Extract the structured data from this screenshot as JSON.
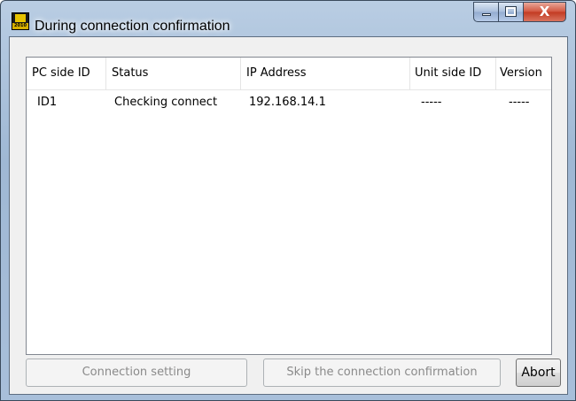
{
  "window": {
    "title": "During connection confirmation",
    "icon_name": "app-icon",
    "caption_buttons": {
      "minimize_icon": "minimize-icon",
      "maximize_icon": "maximize-icon",
      "close_label": "X"
    }
  },
  "table": {
    "headers": [
      "PC side ID",
      "Status",
      "IP Address",
      "Unit side ID",
      "Version"
    ],
    "rows": [
      {
        "pc_side_id": "ID1",
        "status": "Checking connect",
        "ip_address": "192.168.14.1",
        "unit_side_id": "-----",
        "version": "-----"
      }
    ]
  },
  "buttons": {
    "connection_setting": "Connection setting",
    "skip_confirmation": "Skip the connection confirmation",
    "abort": "Abort"
  }
}
